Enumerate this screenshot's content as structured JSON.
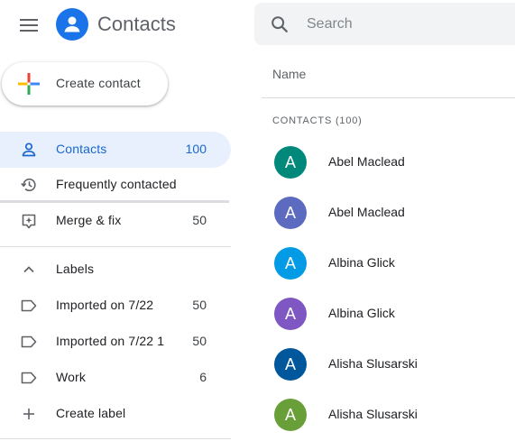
{
  "header": {
    "app_title": "Contacts",
    "menu_icon": "hamburger-menu-icon",
    "logo_icon": "person-circle-icon"
  },
  "search": {
    "placeholder": "Search",
    "value": ""
  },
  "create_button": {
    "label": "Create contact",
    "icon": "multicolor-plus-icon"
  },
  "sidebar": {
    "items": [
      {
        "label": "Contacts",
        "count": "100",
        "icon": "person-outline-icon",
        "active": true
      },
      {
        "label": "Frequently contacted",
        "count": "",
        "icon": "history-icon",
        "active": false
      },
      {
        "label": "Merge & fix",
        "count": "50",
        "icon": "merge-fix-icon",
        "active": false
      }
    ],
    "labels_header": {
      "label": "Labels",
      "icon": "chevron-up-icon"
    },
    "labels": [
      {
        "label": "Imported on 7/22",
        "count": "50",
        "icon": "label-outline-icon"
      },
      {
        "label": "Imported on 7/22 1",
        "count": "50",
        "icon": "label-outline-icon"
      },
      {
        "label": "Work",
        "count": "6",
        "icon": "label-outline-icon"
      }
    ],
    "create_label": {
      "label": "Create label",
      "icon": "plus-icon"
    }
  },
  "list": {
    "column_header": "Name",
    "section_label": "CONTACTS (100)",
    "rows": [
      {
        "initial": "A",
        "name": "Abel Maclead",
        "color": "#00897b"
      },
      {
        "initial": "A",
        "name": "Abel Maclead",
        "color": "#5c6bc0"
      },
      {
        "initial": "A",
        "name": "Albina Glick",
        "color": "#039be5"
      },
      {
        "initial": "A",
        "name": "Albina Glick",
        "color": "#7e57c2"
      },
      {
        "initial": "A",
        "name": "Alisha Slusarski",
        "color": "#01579b"
      },
      {
        "initial": "A",
        "name": "Alisha Slusarski",
        "color": "#689f38"
      }
    ]
  },
  "colors": {
    "accent": "#1a73e8",
    "active_bg": "#e8f0fe",
    "active_text": "#1967d2",
    "divider": "#dadce0"
  }
}
